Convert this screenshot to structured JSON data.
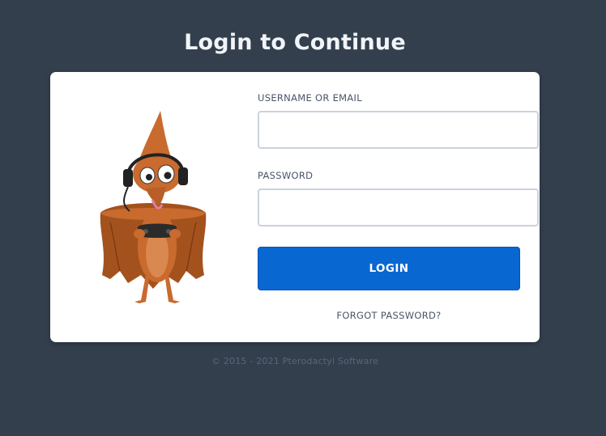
{
  "page": {
    "title": "Login to Continue",
    "footer": "© 2015 - 2021 Pterodactyl Software"
  },
  "form": {
    "username_label": "USERNAME OR EMAIL",
    "username_value": "",
    "password_label": "PASSWORD",
    "password_value": "",
    "login_label": "LOGIN",
    "forgot_label": "FORGOT PASSWORD?"
  },
  "mascot": {
    "icon": "pterodactyl-gamer-mascot",
    "body_color": "#c96a2e",
    "wing_color": "#a4521d",
    "headset_color": "#222222"
  },
  "colors": {
    "background": "#333f4d",
    "primary_button": "#0967d2"
  }
}
